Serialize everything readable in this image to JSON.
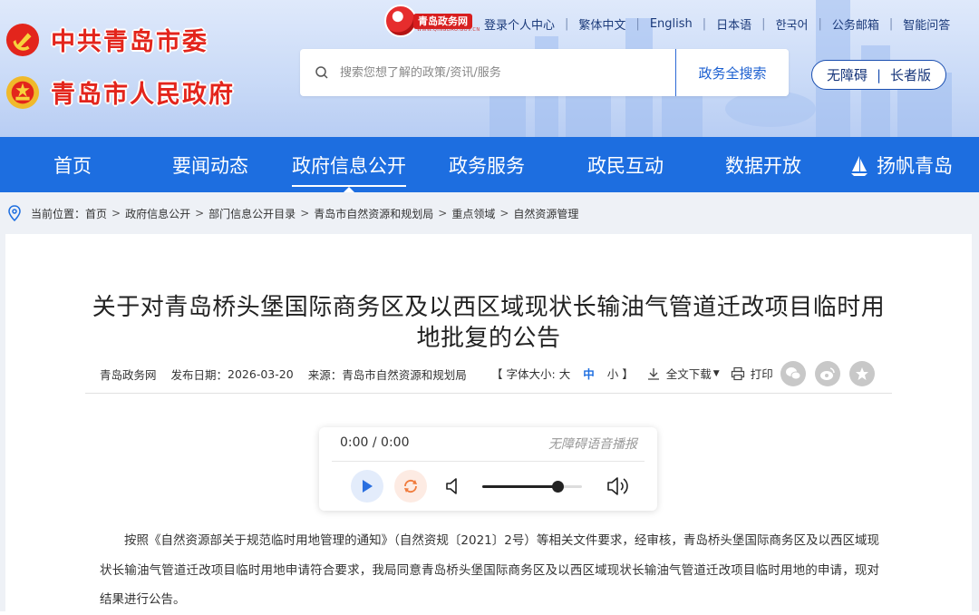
{
  "header": {
    "party_title": "中共青岛市委",
    "gov_title": "青岛市人民政府",
    "site_logo": {
      "text": "青岛政务网",
      "sub": "WWW.QINGDAO.GOV.CN"
    },
    "top_links": [
      "登录个人中心",
      "繁体中文",
      "English",
      "日本语",
      "한국어",
      "公务邮箱",
      "智能问答"
    ],
    "search": {
      "placeholder": "搜索您想了解的政策/资讯/服务",
      "button": "政务全搜索"
    },
    "accessibility": {
      "barrier_free": "无障碍",
      "elderly": "长者版"
    }
  },
  "nav": {
    "items": [
      "首页",
      "要闻动态",
      "政府信息公开",
      "政务服务",
      "政民互动",
      "数据开放",
      "扬帆青岛"
    ],
    "active": "政府信息公开"
  },
  "breadcrumb": {
    "prefix": "当前位置：",
    "items": [
      "首页",
      "政府信息公开",
      "部门信息公开目录",
      "青岛市自然资源和规划局",
      "重点领域",
      "自然资源管理"
    ]
  },
  "article": {
    "title": "关于对青岛桥头堡国际商务区及以西区域现状长输油气管道迁改项目临时用地批复的公告",
    "meta": {
      "site": "青岛政务网",
      "date_label": "发布日期：",
      "date": "2026-03-20",
      "source_label": "来源：",
      "source": "青岛市自然资源和规划局"
    },
    "tools": {
      "font_label": "【 字体大小:",
      "large": "大",
      "medium": "中",
      "small": "小",
      "close_bracket": "】",
      "download": "全文下载",
      "print": "打印"
    },
    "share_icons": [
      "wechat-icon",
      "weibo-icon",
      "favorite-icon"
    ],
    "player": {
      "time": "0:00 / 0:00",
      "label": "无障碍语音播报",
      "volume": 0.75
    },
    "paragraph": "按照《自然资源部关于规范临时用地管理的通知》（自然资规〔2021〕2号）等相关文件要求，经审核，青岛桥头堡国际商务区及以西区域现状长输油气管道迁改项目临时用地申请符合要求，我局同意青岛桥头堡国际商务区及以西区域现状长输油气管道迁改项目临时用地的申请，现对结果进行公告。"
  },
  "colors": {
    "nav_bg": "#1d6ee0",
    "title_red": "#e3251c",
    "crumb_bg": "#eef1f6"
  }
}
